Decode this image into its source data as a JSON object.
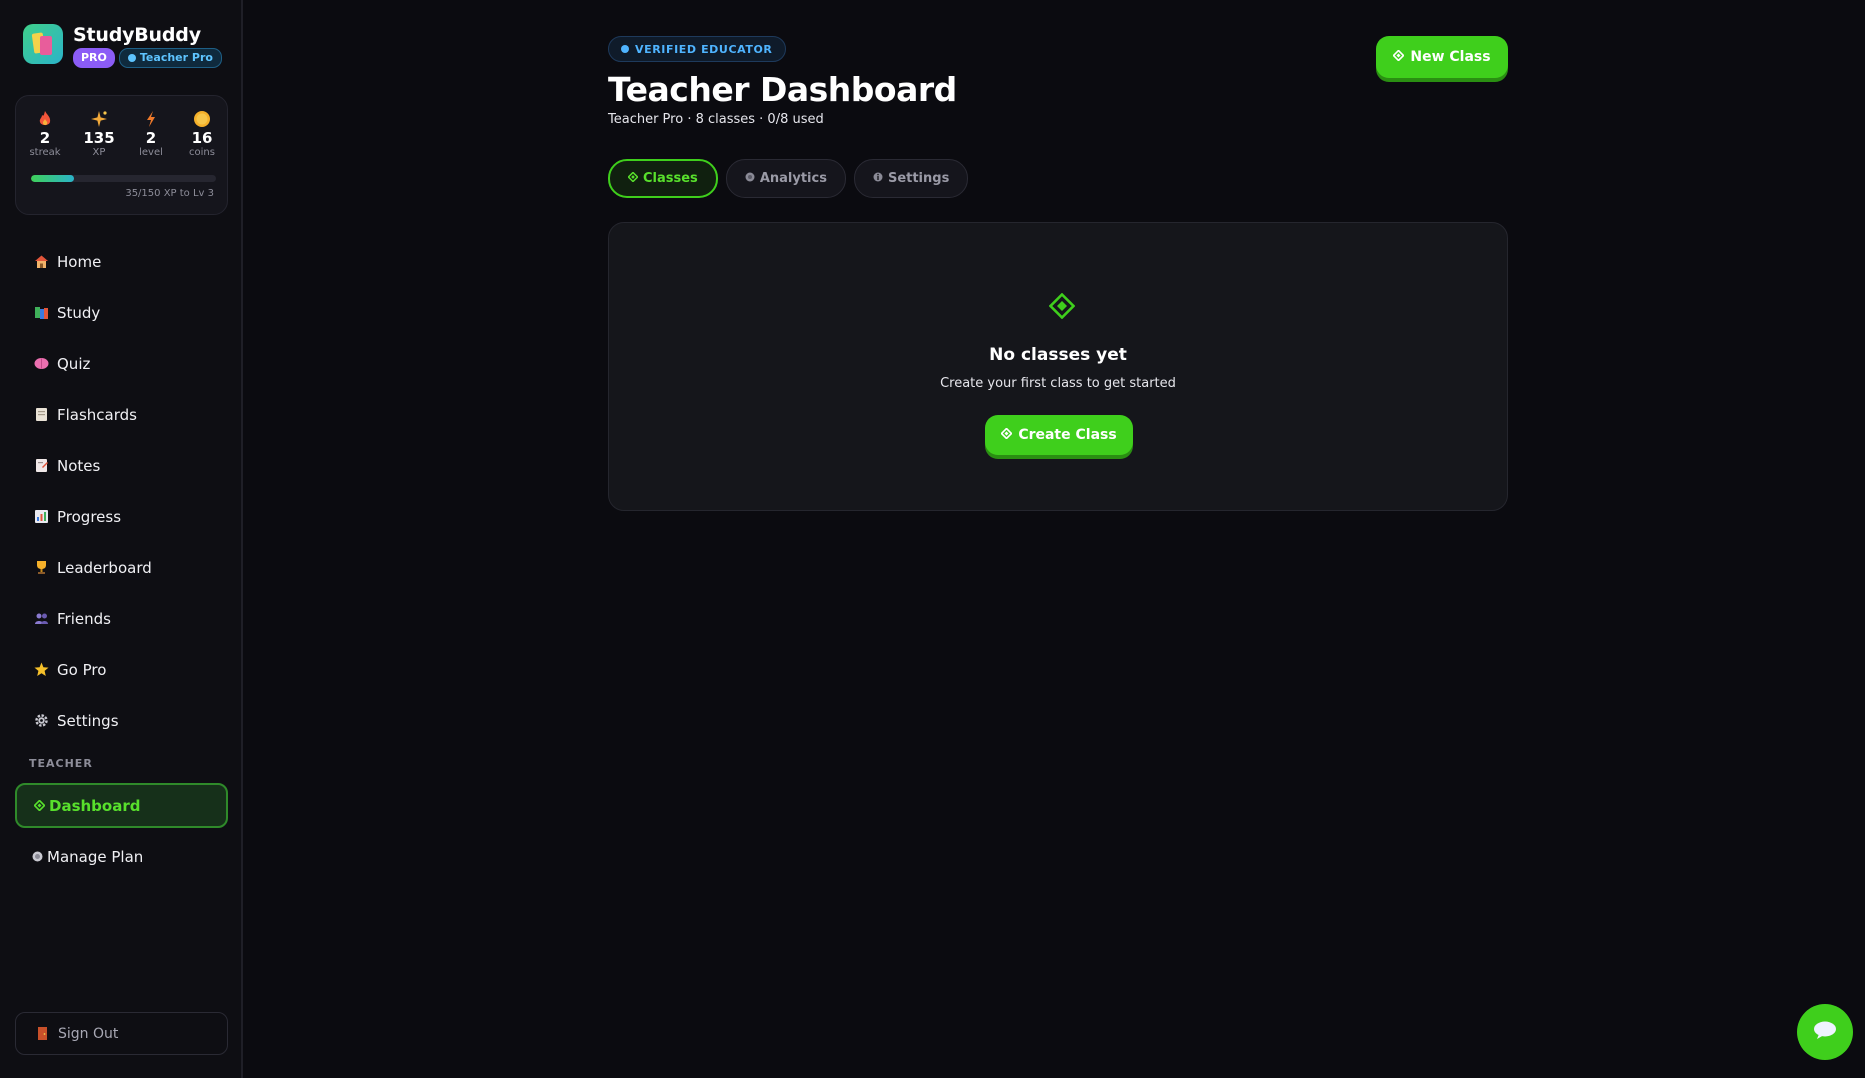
{
  "brand": {
    "name": "StudyBuddy",
    "pro_badge": "PRO",
    "teacher_badge": "Teacher Pro"
  },
  "stats": [
    {
      "icon": "flame-icon",
      "value": "2",
      "label": "streak",
      "color": "#f2553a"
    },
    {
      "icon": "sparkle-icon",
      "value": "135",
      "label": "XP",
      "color": "#f2a93a"
    },
    {
      "icon": "lightning-icon",
      "value": "2",
      "label": "level",
      "color": "#f07a2a"
    },
    {
      "icon": "coin-icon",
      "value": "16",
      "label": "coins",
      "color": "#f5b02a"
    }
  ],
  "xp": {
    "text": "35/150 XP to Lv 3",
    "progress": 0.233
  },
  "nav": [
    {
      "label": "Home",
      "icon": "house-icon"
    },
    {
      "label": "Study",
      "icon": "books-icon"
    },
    {
      "label": "Quiz",
      "icon": "brain-icon"
    },
    {
      "label": "Flashcards",
      "icon": "card-icon"
    },
    {
      "label": "Notes",
      "icon": "note-icon"
    },
    {
      "label": "Progress",
      "icon": "chart-icon"
    },
    {
      "label": "Leaderboard",
      "icon": "trophy-icon"
    },
    {
      "label": "Friends",
      "icon": "people-icon"
    },
    {
      "label": "Go Pro",
      "icon": "star-icon"
    },
    {
      "label": "Settings",
      "icon": "gear-icon"
    }
  ],
  "teacher_section": {
    "label": "TEACHER",
    "items": [
      {
        "label": "Dashboard",
        "icon": "diamond-icon",
        "active": true
      },
      {
        "label": "Manage Plan",
        "icon": "circle-icon",
        "active": false
      }
    ]
  },
  "signout": {
    "label": "Sign Out",
    "icon": "door-icon"
  },
  "header": {
    "verified_badge": "VERIFIED EDUCATOR",
    "title": "Teacher Dashboard",
    "subtitle": "Teacher Pro · 8 classes · 0/8 used",
    "new_class_label": "New Class"
  },
  "tabs": [
    {
      "label": "Classes",
      "active": true
    },
    {
      "label": "Analytics",
      "active": false
    },
    {
      "label": "Settings",
      "active": false
    }
  ],
  "empty_state": {
    "title": "No classes yet",
    "text": "Create your first class to get started",
    "button_label": "Create Class"
  },
  "colors": {
    "accent": "#3fcf1c",
    "accent_text": "#58e02c",
    "background": "#0b0b10",
    "info": "#4fb4ff",
    "pro": "#8b5cf6"
  }
}
